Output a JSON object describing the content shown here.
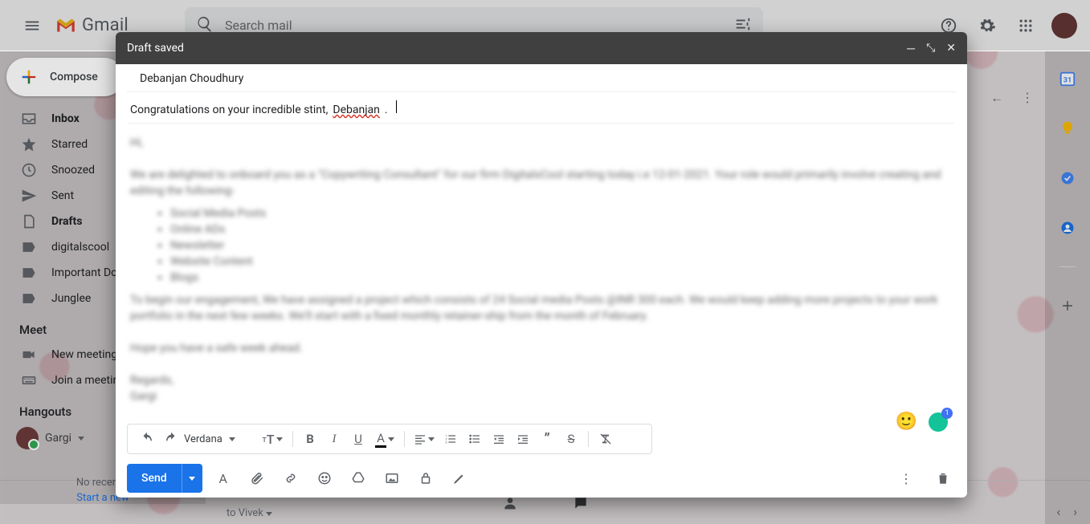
{
  "header": {
    "product": "Gmail",
    "search_placeholder": "Search mail"
  },
  "sidebar": {
    "compose": "Compose",
    "items": [
      {
        "label": "Inbox",
        "bold": true,
        "icon": "inbox"
      },
      {
        "label": "Starred",
        "icon": "star"
      },
      {
        "label": "Snoozed",
        "icon": "clock"
      },
      {
        "label": "Sent",
        "icon": "send"
      },
      {
        "label": "Drafts",
        "bold": true,
        "icon": "file"
      },
      {
        "label": "digitalscool",
        "icon": "label"
      },
      {
        "label": "Important Do…",
        "icon": "label"
      },
      {
        "label": "Junglee",
        "icon": "label"
      }
    ],
    "meet_label": "Meet",
    "meet_items": [
      {
        "label": "New meeting",
        "icon": "video"
      },
      {
        "label": "Join a meetin…",
        "icon": "keyboard"
      }
    ],
    "hangouts_label": "Hangouts",
    "hangouts_user": "Gargi",
    "no_recent": "No recent c",
    "start_new": "Start a new"
  },
  "main": {
    "recipient_line": "to Vivek"
  },
  "compose": {
    "title": "Draft saved",
    "to": "Debanjan Choudhury",
    "subject_prefix": "Congratulations on your incredible stint, ",
    "subject_name": "Debanjan",
    "subject_suffix": ".",
    "font": "Verdana",
    "send": "Send"
  },
  "icons": {
    "search": "search-icon",
    "tune": "tune-icon",
    "help": "help-icon",
    "settings": "settings-icon",
    "apps": "apps-icon"
  }
}
